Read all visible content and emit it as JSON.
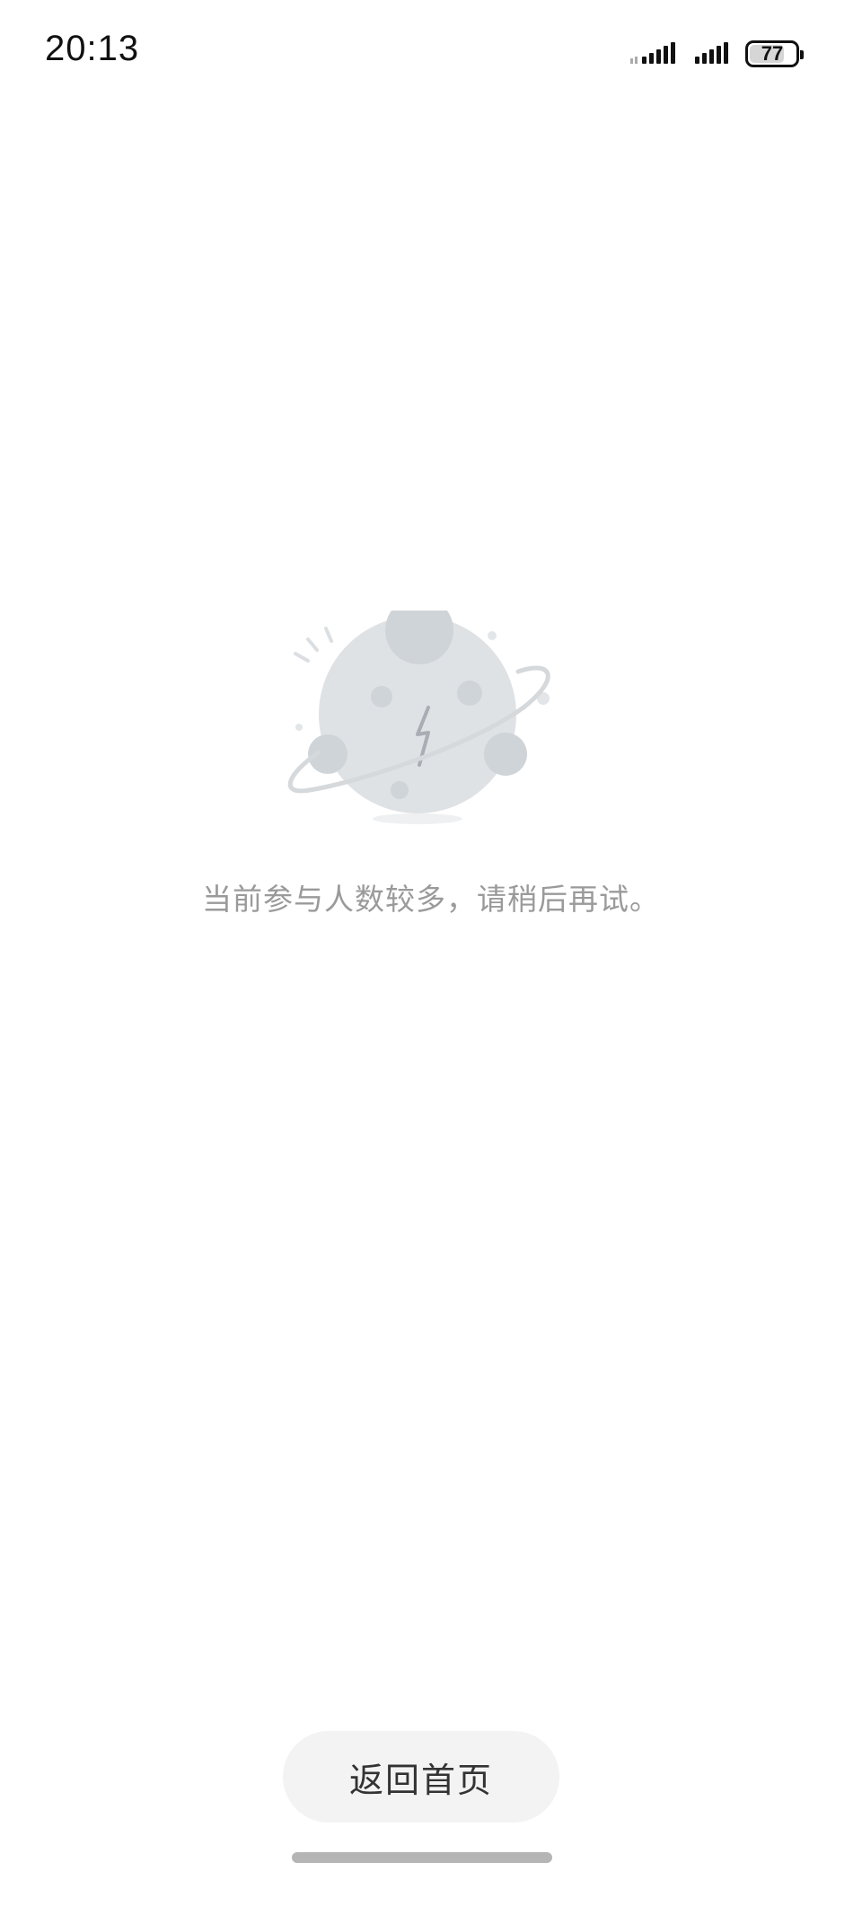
{
  "status_bar": {
    "time": "20:13",
    "battery_level": "77",
    "battery_fraction": 0.77,
    "icons": [
      "signal-icon",
      "signal-icon",
      "battery-icon"
    ]
  },
  "error": {
    "icon": "planet-icon",
    "message": "当前参与人数较多，请稍后再试。"
  },
  "actions": {
    "home_label": "返回首页"
  }
}
